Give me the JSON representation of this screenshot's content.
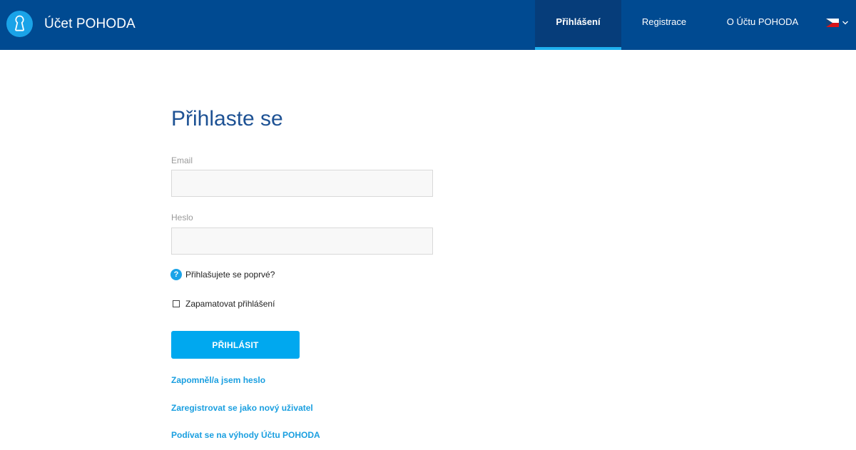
{
  "header": {
    "brand": "Účet POHODA",
    "nav": {
      "login": "Přihlášení",
      "register": "Registrace",
      "about": "O Účtu POHODA"
    },
    "language_icon": "czech-flag-icon",
    "colors": {
      "bar": "#004a91",
      "active_tab": "#063d7a",
      "active_underline": "#1fb1f0",
      "logo": "#1aa3e8"
    }
  },
  "form": {
    "title": "Přihlaste se",
    "email_label": "Email",
    "email_value": "",
    "password_label": "Heslo",
    "password_value": "",
    "help_text": "Přihlašujete se poprvé?",
    "remember_label": "Zapamatovat přihlášení",
    "remember_checked": false,
    "submit_label": "PŘIHLÁSIT"
  },
  "links": {
    "forgot": "Zapomněl/a jsem heslo",
    "register": "Zaregistrovat se jako nový uživatel",
    "benefits": "Podívat se na výhody Účtu POHODA"
  },
  "colors": {
    "title": "#1e5294",
    "button": "#00a8ef",
    "link": "#1a9fe0"
  }
}
